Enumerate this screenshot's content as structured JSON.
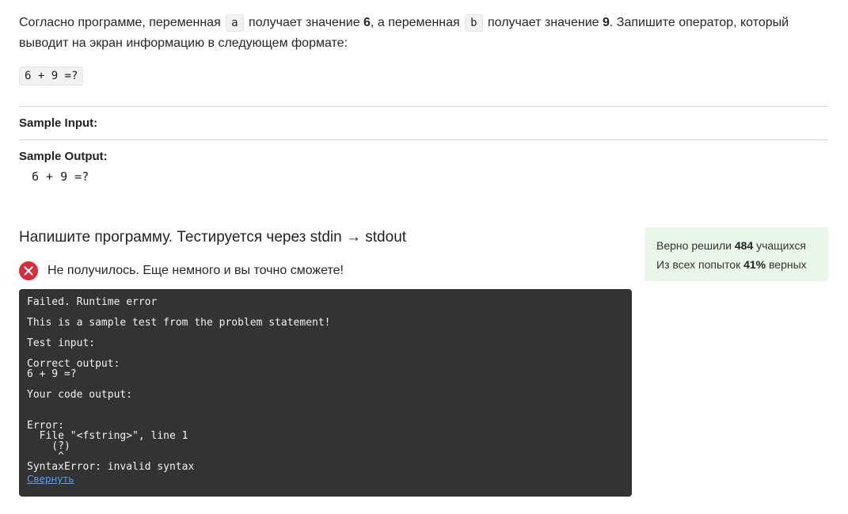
{
  "statement": {
    "t1": "Согласно программе, переменная ",
    "var_a": "a",
    "t2": " получает значение ",
    "val_a": "6",
    "t3": ", а переменная ",
    "var_b": "b",
    "t4": " получает значение ",
    "val_b": "9",
    "t5": ". Запишите оператор, который выводит на экран информацию в следующем формате:",
    "format_example": "6 + 9 =?"
  },
  "sample_input": {
    "label": "Sample Input:",
    "value": ""
  },
  "sample_output": {
    "label": "Sample Output:",
    "value": "6 + 9 =?"
  },
  "task": {
    "heading": "Напишите программу. Тестируется через stdin → stdout"
  },
  "stats": {
    "line1_prefix": "Верно решили ",
    "solved_count": "484",
    "line1_suffix": " учащихся",
    "line2_prefix": "Из всех попыток ",
    "success_rate": "41%",
    "line2_suffix": " верных",
    "bg_color": "#e9f6e9"
  },
  "result": {
    "icon": "close-circle-icon",
    "status_color": "#d92b3a",
    "message": "Не получилось. Еще немного и вы точно сможете!"
  },
  "console": {
    "text": "Failed. Runtime error\n\nThis is a sample test from the problem statement!\n\nTest input:\n\nCorrect output:\n6 + 9 =?\n\nYour code output:\n\n\nError:\n  File \"<fstring>\", line 1\n    (?)\n     ^\nSyntaxError: invalid syntax",
    "collapse_label": "Свернуть",
    "bg_color": "#333333"
  }
}
